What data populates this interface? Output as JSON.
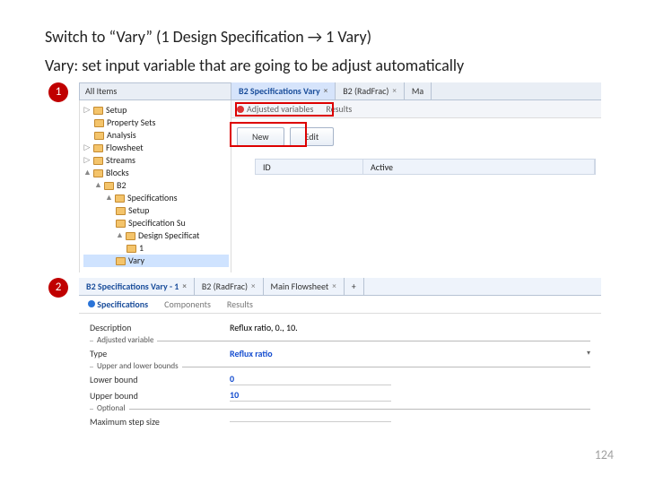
{
  "heading": "Switch to “Vary” (1 Design Specification → 1 Vary)",
  "subheading": "Vary: set input variable that are going to be adjust automatically",
  "badge1": "1",
  "badge2": "2",
  "tree": {
    "header": "All Items",
    "items": {
      "setup": "Setup",
      "propsets": "Property Sets",
      "analysis": "Analysis",
      "flowsheet": "Flowsheet",
      "streams": "Streams",
      "blocks": "Blocks",
      "b2": "B2",
      "specs": "Specifications",
      "setup2": "Setup",
      "specsum": "Specification Su",
      "designspec": "Design Specificat",
      "one": "1",
      "vary": "Vary"
    }
  },
  "panel1": {
    "tabs": {
      "t1": "B2 Specifications Vary",
      "t2": "B2 (RadFrac)",
      "t3": "Ma"
    },
    "subtabs": {
      "s1": "Adjusted variables",
      "s2": "Results"
    },
    "buttons": {
      "new": "New",
      "edit": "Edit"
    },
    "grid": {
      "id": "ID",
      "active": "Active"
    }
  },
  "panel2": {
    "tabs": {
      "t1": "B2 Specifications Vary - 1",
      "t2": "B2 (RadFrac)",
      "t3": "Main Flowsheet",
      "plus": "+"
    },
    "subtabs": {
      "s1": "Specifications",
      "s2": "Components",
      "s3": "Results"
    },
    "desc_label": "Description",
    "desc_val": "Reflux ratio, 0., 10.",
    "adjusted_legend": "Adjusted variable",
    "type_label": "Type",
    "type_val": "Reflux ratio",
    "bounds_legend": "Upper and lower bounds",
    "lower_label": "Lower bound",
    "lower_val": "0",
    "upper_label": "Upper bound",
    "upper_val": "10",
    "optional_legend": "Optional",
    "max_label": "Maximum step size"
  },
  "page": "124"
}
